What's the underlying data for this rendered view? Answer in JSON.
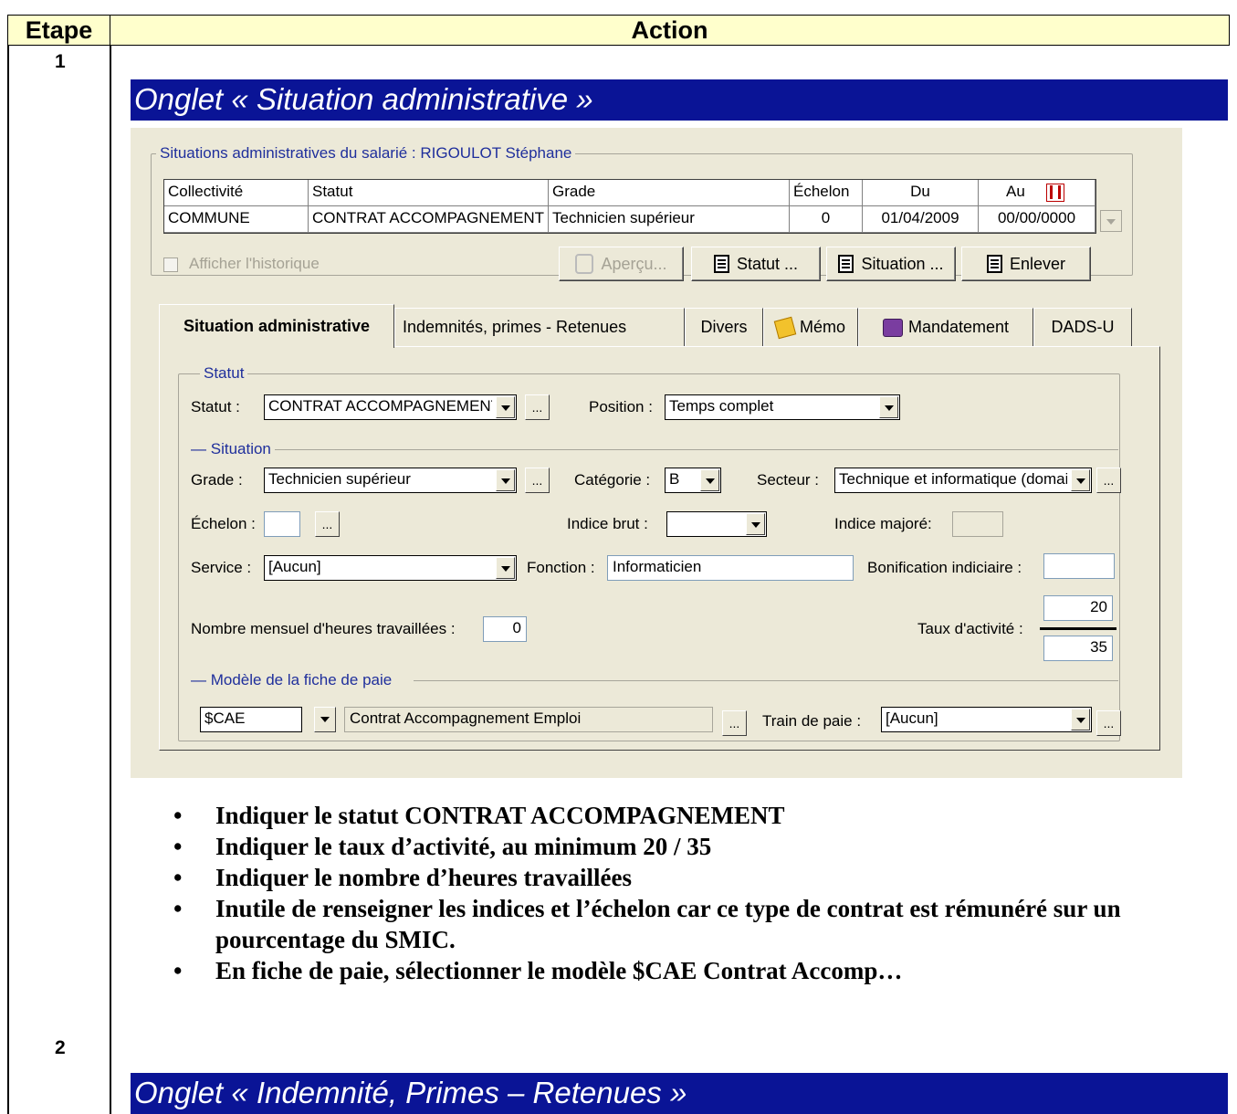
{
  "table": {
    "header_etape": "Etape",
    "header_action": "Action",
    "step1": "1",
    "step2": "2"
  },
  "section1": {
    "title": "Onglet « Situation administrative »"
  },
  "section2": {
    "title": "Onglet « Indemnité, Primes – Retenues »"
  },
  "window": {
    "group_title": "Situations administratives du salarié : RIGOULOT Stéphane",
    "grid": {
      "columns": [
        "Collectivité",
        "Statut",
        "Grade",
        "Échelon",
        "Du",
        "Au"
      ],
      "row": [
        "COMMUNE",
        "CONTRAT ACCOMPAGNEMENT",
        "Technicien supérieur",
        "0",
        "01/04/2009",
        "00/00/0000"
      ]
    },
    "show_history": "Afficher l'historique",
    "buttons": {
      "apercu": "Aperçu...",
      "statut": "Statut ...",
      "situation": "Situation ...",
      "enlever": "Enlever"
    },
    "tabs": [
      "Situation administrative",
      "Indemnités, primes - Retenues",
      "Divers",
      "Mémo",
      "Mandatement",
      "DADS-U"
    ],
    "statut_section": {
      "legend": "Statut",
      "statut_label": "Statut :",
      "statut_value": "CONTRAT ACCOMPAGNEMENT",
      "position_label": "Position :",
      "position_value": "Temps complet"
    },
    "situation_section": {
      "legend": "Situation",
      "grade_label": "Grade :",
      "grade_value": "Technicien supérieur",
      "categorie_label": "Catégorie :",
      "categorie_value": "B",
      "secteur_label": "Secteur :",
      "secteur_value": "Technique et informatique (domaine)",
      "echelon_label": "Échelon :",
      "echelon_value": "",
      "indice_brut_label": "Indice brut :",
      "indice_brut_value": "",
      "indice_majore_label": "Indice majoré:",
      "service_label": "Service :",
      "service_value": "[Aucun]",
      "fonction_label": "Fonction :",
      "fonction_value": "Informaticien",
      "bonification_label": "Bonification indiciaire :",
      "heures_label": "Nombre mensuel d'heures travaillées :",
      "heures_value": "0",
      "taux_label": "Taux d'activité :",
      "taux_num": "20",
      "taux_den": "35"
    },
    "modele_section": {
      "legend": "Modèle de la fiche de paie",
      "code": "$CAE",
      "libelle": "Contrat Accompagnement Emploi",
      "train_label": "Train de paie :",
      "train_value": "[Aucun]"
    }
  },
  "instructions": [
    "Indiquer le statut CONTRAT ACCOMPAGNEMENT",
    "Indiquer le taux d’activité, au minimum 20 / 35",
    "Indiquer le nombre d’heures travaillées",
    "Inutile de renseigner les indices et l’échelon car ce type de contrat est rémunéré sur un pourcentage du SMIC.",
    "En fiche de paie, sélectionner le modèle $CAE Contrat Accomp…"
  ]
}
